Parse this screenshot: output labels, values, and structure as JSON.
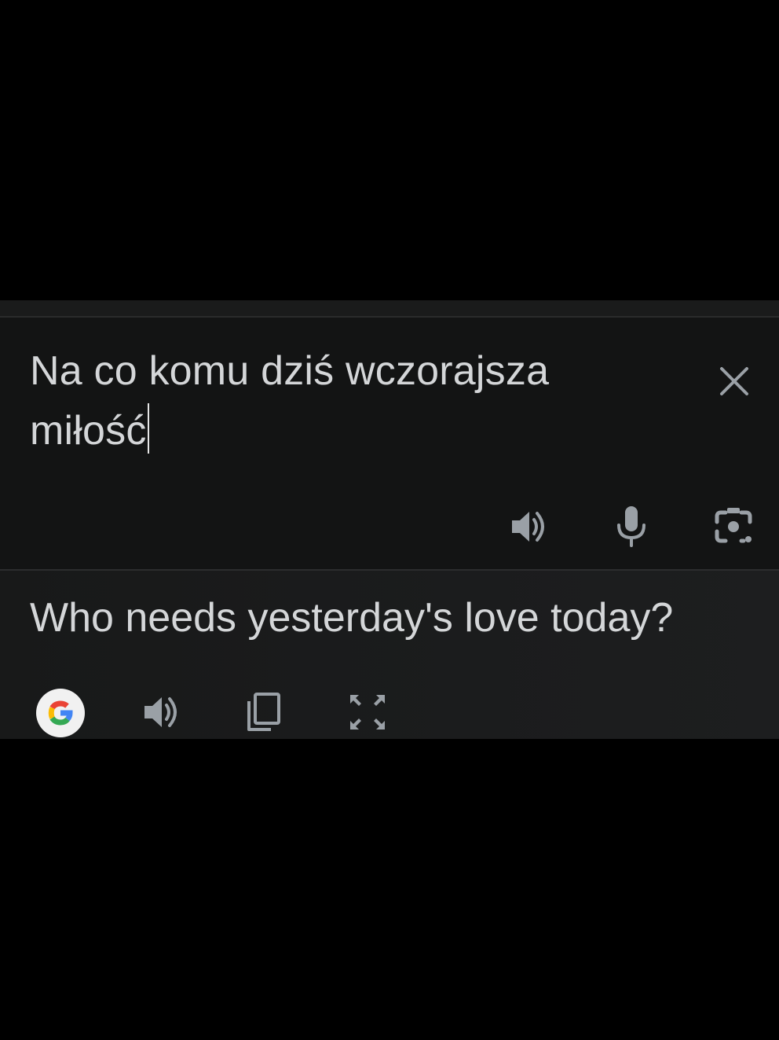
{
  "source": {
    "text_line1": "Na co komu dziś wczorajsza",
    "text_line2": "miłość",
    "icons": {
      "close": "close-icon",
      "speak": "speaker-icon",
      "mic": "microphone-icon",
      "camera": "camera-icon"
    }
  },
  "translation": {
    "text": "Who needs yesterday's love today?",
    "icons": {
      "google": "google-logo-icon",
      "speak": "speaker-icon",
      "copy": "copy-icon",
      "fullscreen": "fullscreen-icon"
    }
  },
  "colors": {
    "background": "#000000",
    "panel": "#141515",
    "text": "#d4d6d8",
    "icon": "#9aa0a6",
    "divider": "#2c2d2e"
  }
}
